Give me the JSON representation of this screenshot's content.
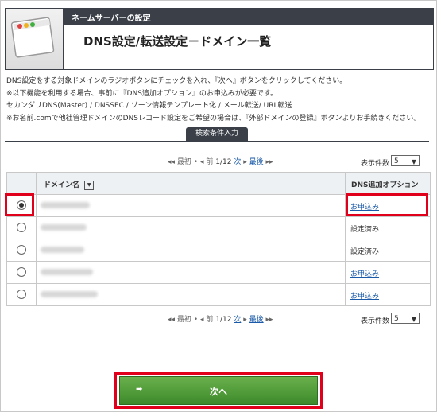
{
  "header": {
    "category": "ネームサーバーの設定",
    "title": "DNS設定/転送設定－ドメイン一覧"
  },
  "info": {
    "line1": "DNS設定をする対象ドメインのラジオボタンにチェックを入れ、『次へ』ボタンをクリックしてください。",
    "line2": "※以下機能を利用する場合、事前に『DNS追加オプション』のお申込みが必要です。",
    "line3": "セカンダリDNS(Master) / DNSSEC / ゾーン情報テンプレート化 / メール転送/ URL転送",
    "line4": "※お名前.comで他社管理ドメインのDNSレコード設定をご希望の場合は、『外部ドメインの登録』ボタンよりお手続きください。"
  },
  "search_tab": "検索条件入力",
  "pager": {
    "first": "◂◂ 最初",
    "prev": "◂ 前",
    "position": "1/12",
    "next": "次",
    "last": "最後",
    "last_arrow": "▸▸",
    "next_arrow": "▸",
    "per_page_label": "表示件数",
    "per_page_value": "5"
  },
  "table": {
    "col_domain": "ドメイン名",
    "sort_icon": "▼",
    "col_option": "DNS追加オプション",
    "rows": [
      {
        "selected": true,
        "option": "お申込み",
        "link": true
      },
      {
        "selected": false,
        "option": "設定済み",
        "link": false
      },
      {
        "selected": false,
        "option": "設定済み",
        "link": false
      },
      {
        "selected": false,
        "option": "お申込み",
        "link": true
      },
      {
        "selected": false,
        "option": "お申込み",
        "link": true
      }
    ]
  },
  "next_button": {
    "label": "次へ",
    "arrow": "➡"
  },
  "colors": {
    "header_dark": "#3a3f48",
    "link": "#1a5aa8",
    "highlight": "#e0001b",
    "button_green": "#4f9a37"
  }
}
